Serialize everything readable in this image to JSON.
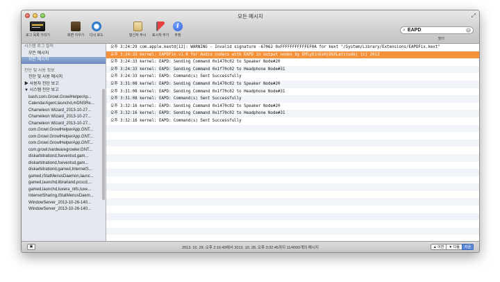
{
  "window": {
    "title": "모든 메시지"
  },
  "toolbar": {
    "items": [
      {
        "label": "로그 목록 가리기",
        "icon": "log-list-icon"
      },
      {
        "label": "화면 지우기",
        "icon": "clear-display-icon"
      },
      {
        "label": "다시 로드",
        "icon": "reload-icon"
      },
      {
        "label": "발신자 무시",
        "icon": "ignore-sender-icon"
      },
      {
        "label": "표시자 추가",
        "icon": "add-marker-icon"
      },
      {
        "label": "추정",
        "icon": "info-icon"
      }
    ],
    "search_value": "EAPD",
    "filter_label": "필터"
  },
  "sidebar": {
    "rows": [
      {
        "text": "시스템 로그 질의",
        "kind": "head"
      },
      {
        "text": "모든 메시지",
        "kind": "indent"
      },
      {
        "text": "모든 메시지",
        "kind": "selected"
      },
      {
        "text": "",
        "kind": "gap"
      },
      {
        "text": "진단 및 사용 정보",
        "kind": "head"
      },
      {
        "text": "진단 및 사용 메시지",
        "kind": "indent"
      },
      {
        "text": "▶ 사용자 진단 보고",
        "kind": "plain"
      },
      {
        "text": "▼ 시스템 진단 보고",
        "kind": "plain"
      },
      {
        "text": "bash,com.Growl.GrowlHelperAp...",
        "kind": "indent"
      },
      {
        "text": "CalendarAgent,launchd,mDNSRe...",
        "kind": "indent"
      },
      {
        "text": "Chameleon Wizard_2013-10-27...",
        "kind": "indent"
      },
      {
        "text": "Chameleon Wizard_2013-10-27...",
        "kind": "indent"
      },
      {
        "text": "Chameleon Wizard_2013-10-27...",
        "kind": "indent"
      },
      {
        "text": "com.Growl.GrowlHelperApp.GNT...",
        "kind": "indent"
      },
      {
        "text": "com.Growl.GrowlHelperApp.GNT...",
        "kind": "indent"
      },
      {
        "text": "com.Growl.GrowlHelperApp.GNT...",
        "kind": "indent"
      },
      {
        "text": "com.growl.hardwaregrowler.GNT...",
        "kind": "indent"
      },
      {
        "text": "diskarbitrationd,fseventsd,gam...",
        "kind": "indent"
      },
      {
        "text": "diskarbitrationd,fseventsd,gam...",
        "kind": "indent"
      },
      {
        "text": "diskarbitrationd,gamed,InternetS...",
        "kind": "indent"
      },
      {
        "text": "gamed,iStatMenusDaemon,launc...",
        "kind": "indent"
      },
      {
        "text": "gamed,launchd,librariand,pcscd,...",
        "kind": "indent"
      },
      {
        "text": "gamed,launchd,tuxera_ntfs,tuxe...",
        "kind": "indent"
      },
      {
        "text": "InternetSharing,iStatMenusDaem...",
        "kind": "indent"
      },
      {
        "text": "WindowServer_2013-10-26-140...",
        "kind": "indent"
      },
      {
        "text": "WindowServer_2013-10-26-140...",
        "kind": "indent"
      }
    ]
  },
  "log": {
    "rows": [
      {
        "text": "오후 3:24:29 com.apple.kextd[12]: WARNING - Invalid signature -67062 0xFFFFFFFFFFFEF0A for kext \"/System/Library/Extensions/EAPDFix.kext\"",
        "highlight": false
      },
      {
        "text": "오후 3:24:33 kernel: EAPDFix v1.0 for Audio codecs with EAPD in output nodes by EMlyDinEsH(OSXLatitude) (c) 2013",
        "highlight": true
      },
      {
        "text": "오후 3:24:33 kernel: EAPD: Sending Command 0x1470c02 to Speaker Node#20",
        "highlight": false
      },
      {
        "text": "오후 3:24:33 kernel: EAPD: Sending Command 0x1f70c02 to Headphone Node#31",
        "highlight": false
      },
      {
        "text": "오후 3:24:33 kernel: EAPD: Command(s) Sent Successfully",
        "highlight": false
      },
      {
        "text": "오후 3:31:08 kernel: EAPD: Sending Command 0x1470c02 to Speaker Node#20",
        "highlight": false
      },
      {
        "text": "오후 3:31:08 kernel: EAPD: Sending Command 0x1f70c02 to Headphone Node#31",
        "highlight": false
      },
      {
        "text": "오후 3:31:08 kernel: EAPD: Command(s) Sent Successfully",
        "highlight": false
      },
      {
        "text": "오후 3:32:16 kernel: EAPD: Sending Command 0x1470c02 to Speaker Node#20",
        "highlight": false
      },
      {
        "text": "오후 3:32:16 kernel: EAPD: Sending Command 0x1f70c02 to Headphone Node#31",
        "highlight": false
      },
      {
        "text": "오후 3:32:16 kernel: EAPD: Command(s) Sent Successfully",
        "highlight": false
      }
    ]
  },
  "status": {
    "text": "2013. 10. 28. 오후 2:16:49에서 2013. 10. 28. 오후 3:32:45까지 11/4000개의 메시지",
    "prev_label": "▲ 이전",
    "next_label": "▼ 다음",
    "today_label": "지금"
  },
  "colors": {
    "highlight": "#f5913a",
    "selection": "#6e8cbf"
  }
}
